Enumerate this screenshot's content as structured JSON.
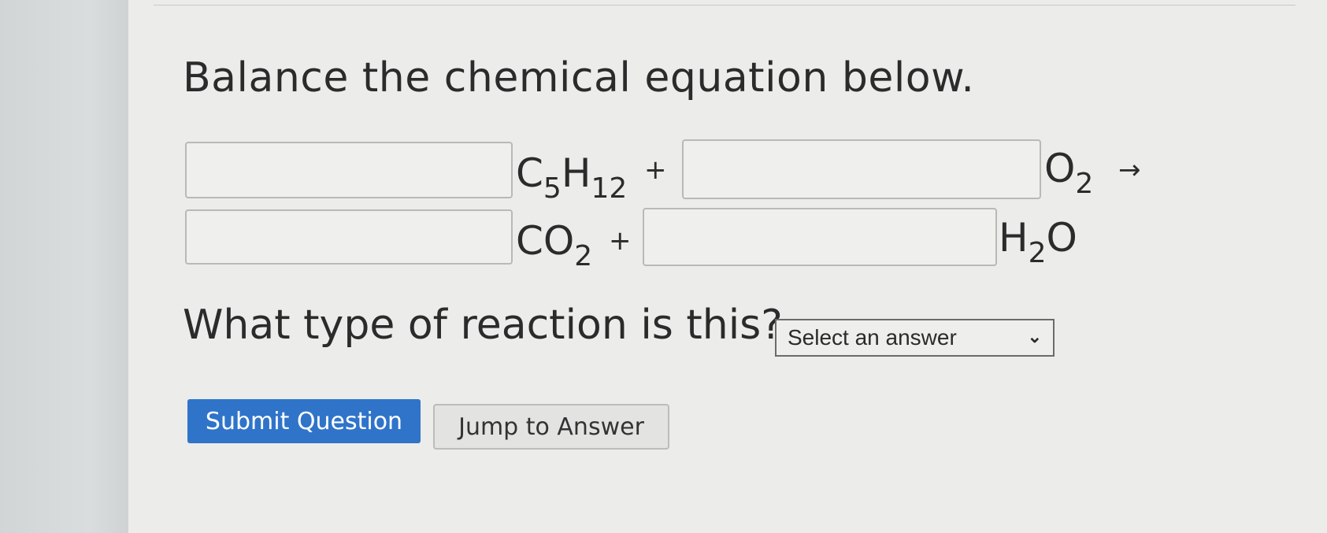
{
  "question": {
    "title": "Balance the chemical equation below.",
    "prompt": "What type of reaction is this?"
  },
  "equation": {
    "line1": {
      "reactant1": {
        "symbol_a": "C",
        "sub_a": "5",
        "symbol_b": "H",
        "sub_b": "12"
      },
      "plus": "+",
      "reactant2": {
        "symbol": "O",
        "sub": "2"
      },
      "arrow": "→"
    },
    "line2": {
      "product1": {
        "symbol": "CO",
        "sub": "2"
      },
      "plus": "+",
      "product2": {
        "symbol_a": "H",
        "sub": "2",
        "symbol_b": "O"
      }
    },
    "coefficients": [
      "",
      "",
      "",
      ""
    ]
  },
  "reaction_type_select": {
    "selected": "Select an answer"
  },
  "buttons": {
    "submit": "Submit Question",
    "jump": "Jump to Answer"
  }
}
